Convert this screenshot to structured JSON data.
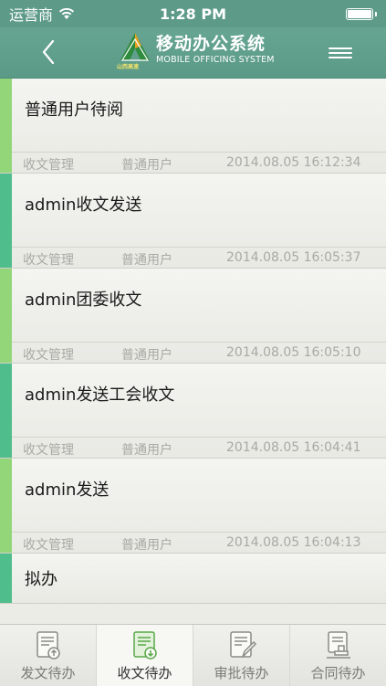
{
  "status_bar": {
    "carrier": "运营商",
    "time": "1:28 PM",
    "battery_level": 1.0
  },
  "nav": {
    "back_icon": "chevron-left-icon",
    "logo_icon": "company-logo",
    "logo_caption": "山西高速",
    "app_title": "移动办公系统",
    "app_subtitle": "MOBILE OFFICING SYSTEM",
    "menu_icon": "hamburger-menu-icon"
  },
  "list": {
    "items": [
      {
        "title": "普通用户待阅",
        "category": "收文管理",
        "user": "普通用户",
        "time": "2014.08.05 16:12:34",
        "accent": "#93d67a"
      },
      {
        "title": "admin收文发送",
        "category": "收文管理",
        "user": "普通用户",
        "time": "2014.08.05 16:05:37",
        "accent": "#4fbe8c"
      },
      {
        "title": "admin团委收文",
        "category": "收文管理",
        "user": "普通用户",
        "time": "2014.08.05 16:05:10",
        "accent": "#93d67a"
      },
      {
        "title": "admin发送工会收文",
        "category": "收文管理",
        "user": "普通用户",
        "time": "2014.08.05 16:04:41",
        "accent": "#4fbe8c"
      },
      {
        "title": "admin发送",
        "category": "收文管理",
        "user": "普通用户",
        "time": "2014.08.05 16:04:13",
        "accent": "#93d67a"
      },
      {
        "title": "拟办",
        "accent": "#4fbe8c"
      }
    ]
  },
  "tab_bar": {
    "tabs": [
      {
        "label": "发文待办",
        "icon": "document-upload-icon",
        "active": false
      },
      {
        "label": "收文待办",
        "icon": "document-download-icon",
        "active": true
      },
      {
        "label": "审批待办",
        "icon": "document-edit-icon",
        "active": false
      },
      {
        "label": "合同待办",
        "icon": "contract-stamp-icon",
        "active": false
      }
    ]
  }
}
